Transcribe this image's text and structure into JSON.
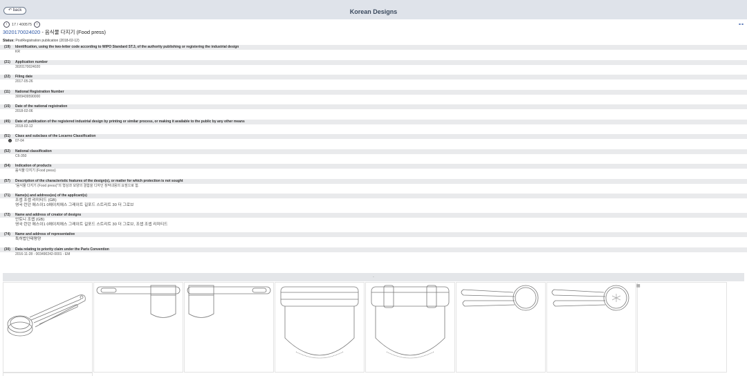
{
  "header": {
    "back_label": "back",
    "title": "Korean Designs"
  },
  "pager": {
    "text": "17 / 400575",
    "prev_glyph": "‹",
    "next_glyph": "›"
  },
  "record": {
    "number": "3020170024020",
    "separator": " - ",
    "name": "음식물 다지기 (Food press)",
    "share_glyph": "⚭⚭"
  },
  "status": {
    "label": "Status:",
    "value": "PostRegistration publication (2018-02-12)"
  },
  "fields": [
    {
      "code": "(19)",
      "label": "Identification, using the two-letter code according to WIPO Standard ST.3, of the authority publishing or registering the industrial design",
      "value": "KR"
    },
    {
      "code": "(21)",
      "label": "Application number",
      "value": "3020170024020"
    },
    {
      "code": "(22)",
      "label": "Filing date",
      "value": "2017-05-26"
    },
    {
      "code": "(11)",
      "label": "National Registration Number",
      "value": "3009439590000"
    },
    {
      "code": "(15)",
      "label": "Date of the national registration",
      "value": "2018-02-06"
    },
    {
      "code": "(45)",
      "label": "Date of publication of the registered industrial design by printing or similar process, or making it available to the public by any other means",
      "value": "2018-02-12"
    },
    {
      "code": "(51)",
      "label": "Class and subclass of the Locarno Classification",
      "value": "07-04"
    },
    {
      "code": "(52)",
      "label": "National classification",
      "value": "C6-350"
    },
    {
      "code": "(54)",
      "label": "Indication of products",
      "value": "음식물 다지기 (Food press)"
    },
    {
      "code": "(57)",
      "label": "Description of the characteristic features of the design(s), or matter for which protection is not sought",
      "value": "\"음식물 다지기 (Food press)\"의 형상과 모양의 결합을 디자인 창작내용의 요점으로 함."
    },
    {
      "code": "(71)",
      "label": "Name(s) and address(es) of the applicant(s)",
      "value": "조셉 조셉 리미티드 (GB)",
      "value2": "영국 런던 에스이1 0에이치에스 그레이트 길포드 스트리트 30 더 그로브"
    },
    {
      "code": "(72)",
      "label": "Name and address of creator of designs",
      "value": "안토니 조셉 (GB)",
      "value2": "영국 런던 에스이1 0에이치에스 그레이트 길포드 스트리트 30 더 그로브, 조셉 조셉 리미티드"
    },
    {
      "code": "(74)",
      "label": "Name and address of representative",
      "value": "특허법인태평양"
    },
    {
      "code": "(30)",
      "label": "Data relating to priority claim under the Paris Convention",
      "value": "2016-11-28 - 003490242-0001 - EM"
    }
  ],
  "images": {
    "bar_text": "-"
  }
}
